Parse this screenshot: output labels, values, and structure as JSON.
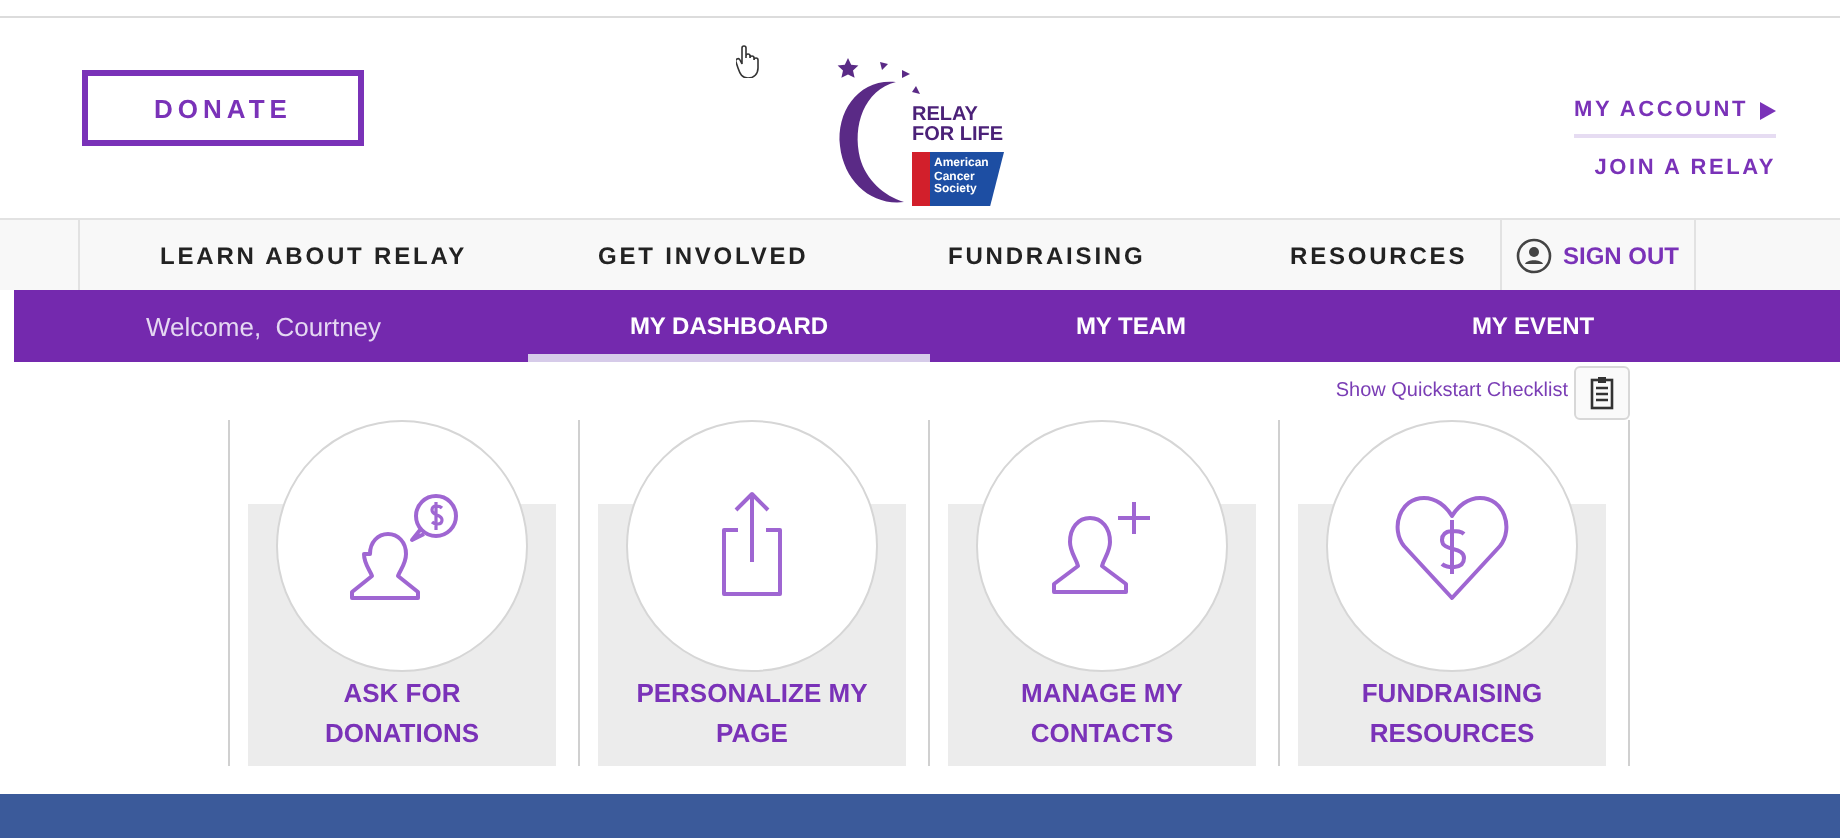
{
  "header": {
    "donate": "DONATE",
    "logo": {
      "title_lines": [
        "RELAY",
        "FOR LIFE"
      ],
      "society": "American Cancer Society"
    },
    "account_links": [
      {
        "label": "MY ACCOUNT",
        "kind": "arrow"
      },
      {
        "label": "JOIN A RELAY",
        "kind": "plain"
      }
    ]
  },
  "main_nav": {
    "items": [
      "LEARN ABOUT RELAY",
      "GET INVOLVED",
      "FUNDRAISING",
      "RESOURCES"
    ],
    "sign_out": "SIGN OUT"
  },
  "sub_nav": {
    "welcome": "Welcome,  Courtney",
    "tabs": [
      {
        "label": "MY DASHBOARD",
        "selected": true
      },
      {
        "label": "MY TEAM",
        "selected": false
      },
      {
        "label": "MY EVENT",
        "selected": false
      }
    ]
  },
  "quickstart": {
    "label": "Show Quickstart Checklist"
  },
  "cards": [
    {
      "kind": "ask",
      "label": "ASK FOR\nDONATIONS"
    },
    {
      "kind": "share",
      "label": "PERSONALIZE MY\nPAGE"
    },
    {
      "kind": "contact",
      "label": "MANAGE MY\nCONTACTS"
    },
    {
      "kind": "heart",
      "label": "FUNDRAISING\nRESOURCES"
    }
  ]
}
